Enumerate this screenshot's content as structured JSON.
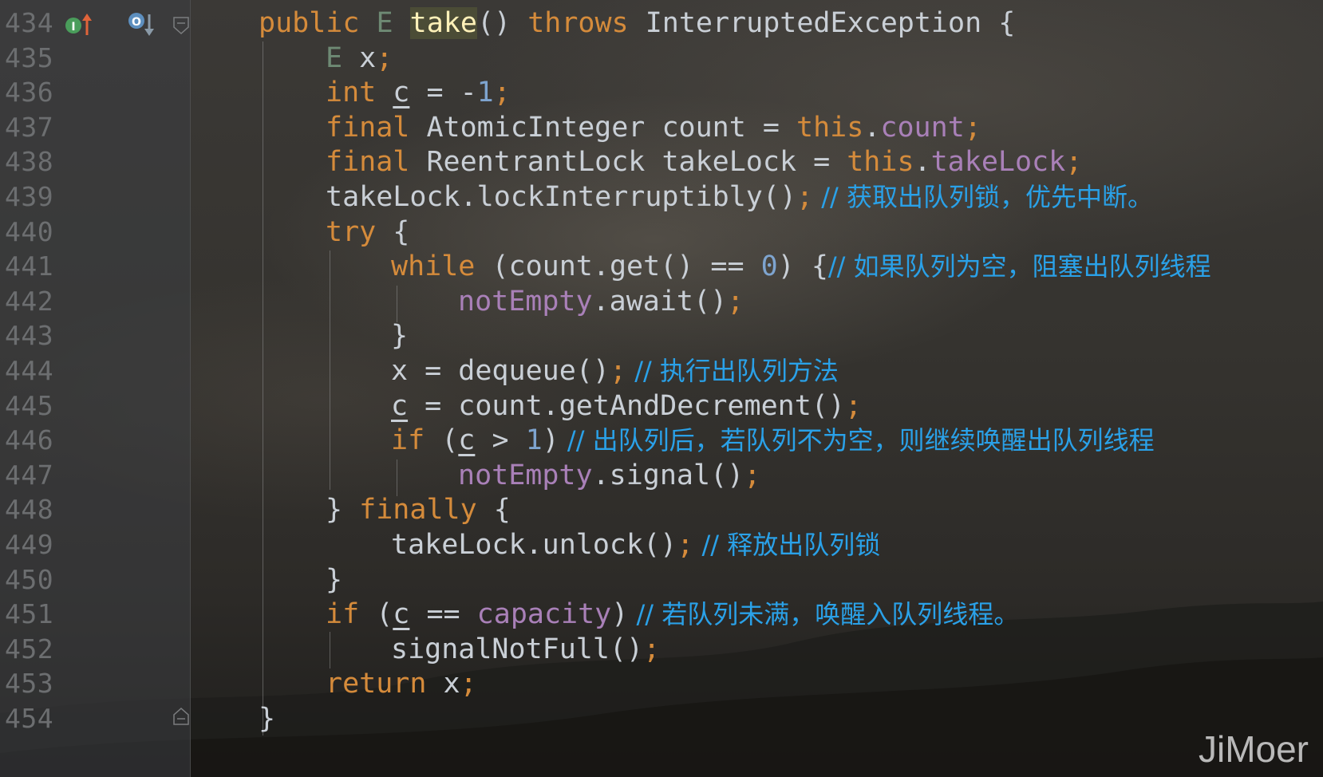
{
  "editor": {
    "lines": [
      {
        "num": "434",
        "segments": [
          {
            "t": "public ",
            "c": "kw"
          },
          {
            "t": "E ",
            "c": "tp"
          },
          {
            "t": "take",
            "c": "fn-hl"
          },
          {
            "t": "() ",
            "c": ""
          },
          {
            "t": "throws ",
            "c": "kw"
          },
          {
            "t": "InterruptedException {",
            "c": ""
          }
        ],
        "comment": ""
      },
      {
        "num": "435",
        "segments": [
          {
            "t": "E ",
            "c": "tp"
          },
          {
            "t": "x",
            "c": ""
          },
          {
            "t": ";",
            "c": "kw"
          }
        ],
        "comment": ""
      },
      {
        "num": "436",
        "segments": [
          {
            "t": "int ",
            "c": "kw"
          },
          {
            "t": "c",
            "c": "u"
          },
          {
            "t": " = -",
            "c": ""
          },
          {
            "t": "1",
            "c": "num"
          },
          {
            "t": ";",
            "c": "kw"
          }
        ],
        "comment": ""
      },
      {
        "num": "437",
        "segments": [
          {
            "t": "final ",
            "c": "kw"
          },
          {
            "t": "AtomicInteger count = ",
            "c": ""
          },
          {
            "t": "this",
            "c": "kw"
          },
          {
            "t": ".",
            "c": ""
          },
          {
            "t": "count",
            "c": "fld"
          },
          {
            "t": ";",
            "c": "kw"
          }
        ],
        "comment": ""
      },
      {
        "num": "438",
        "segments": [
          {
            "t": "final ",
            "c": "kw"
          },
          {
            "t": "ReentrantLock takeLock = ",
            "c": ""
          },
          {
            "t": "this",
            "c": "kw"
          },
          {
            "t": ".",
            "c": ""
          },
          {
            "t": "takeLock",
            "c": "fld"
          },
          {
            "t": ";",
            "c": "kw"
          }
        ],
        "comment": ""
      },
      {
        "num": "439",
        "segments": [
          {
            "t": "takeLock.lockInterruptibly()",
            "c": ""
          },
          {
            "t": ";",
            "c": "kw"
          }
        ],
        "comment": " // 获取出队列锁，优先中断。"
      },
      {
        "num": "440",
        "segments": [
          {
            "t": "try ",
            "c": "kw"
          },
          {
            "t": "{",
            "c": ""
          }
        ],
        "comment": ""
      },
      {
        "num": "441",
        "segments": [
          {
            "t": "while ",
            "c": "kw"
          },
          {
            "t": "(count.get() == ",
            "c": ""
          },
          {
            "t": "0",
            "c": "num"
          },
          {
            "t": ") {",
            "c": ""
          }
        ],
        "comment": "// 如果队列为空，阻塞出队列线程"
      },
      {
        "num": "442",
        "segments": [
          {
            "t": "notEmpty",
            "c": "fld"
          },
          {
            "t": ".await()",
            "c": ""
          },
          {
            "t": ";",
            "c": "kw"
          }
        ],
        "comment": ""
      },
      {
        "num": "443",
        "segments": [
          {
            "t": "}",
            "c": ""
          }
        ],
        "comment": ""
      },
      {
        "num": "444",
        "segments": [
          {
            "t": "x = dequeue()",
            "c": ""
          },
          {
            "t": ";",
            "c": "kw"
          }
        ],
        "comment": " // 执行出队列方法"
      },
      {
        "num": "445",
        "segments": [
          {
            "t": "c",
            "c": "u"
          },
          {
            "t": " = count.getAndDecrement()",
            "c": ""
          },
          {
            "t": ";",
            "c": "kw"
          }
        ],
        "comment": ""
      },
      {
        "num": "446",
        "segments": [
          {
            "t": "if ",
            "c": "kw"
          },
          {
            "t": "(",
            "c": ""
          },
          {
            "t": "c",
            "c": "u"
          },
          {
            "t": " > ",
            "c": ""
          },
          {
            "t": "1",
            "c": "num"
          },
          {
            "t": ")",
            "c": ""
          }
        ],
        "comment": " // 出队列后，若队列不为空，则继续唤醒出队列线程"
      },
      {
        "num": "447",
        "segments": [
          {
            "t": "notEmpty",
            "c": "fld"
          },
          {
            "t": ".signal()",
            "c": ""
          },
          {
            "t": ";",
            "c": "kw"
          }
        ],
        "comment": ""
      },
      {
        "num": "448",
        "segments": [
          {
            "t": "} ",
            "c": ""
          },
          {
            "t": "finally ",
            "c": "kw"
          },
          {
            "t": "{",
            "c": ""
          }
        ],
        "comment": ""
      },
      {
        "num": "449",
        "segments": [
          {
            "t": "takeLock.unlock()",
            "c": ""
          },
          {
            "t": ";",
            "c": "kw"
          }
        ],
        "comment": " // 释放出队列锁"
      },
      {
        "num": "450",
        "segments": [
          {
            "t": "}",
            "c": ""
          }
        ],
        "comment": ""
      },
      {
        "num": "451",
        "segments": [
          {
            "t": "if ",
            "c": "kw"
          },
          {
            "t": "(",
            "c": ""
          },
          {
            "t": "c",
            "c": "u"
          },
          {
            "t": " == ",
            "c": ""
          },
          {
            "t": "capacity",
            "c": "fld"
          },
          {
            "t": ")",
            "c": ""
          }
        ],
        "comment": " // 若队列未满，唤醒入队列线程。"
      },
      {
        "num": "452",
        "segments": [
          {
            "t": "signalNotFull()",
            "c": ""
          },
          {
            "t": ";",
            "c": "kw"
          }
        ],
        "comment": ""
      },
      {
        "num": "453",
        "segments": [
          {
            "t": "return ",
            "c": "kw"
          },
          {
            "t": "x",
            "c": ""
          },
          {
            "t": ";",
            "c": "kw"
          }
        ],
        "comment": ""
      },
      {
        "num": "454",
        "segments": [
          {
            "t": "}",
            "c": ""
          }
        ],
        "comment": ""
      }
    ]
  },
  "gutter_icons": {
    "implements_icon": "implementing-method-up-icon",
    "overrides_icon": "overridden-method-down-icon",
    "fold_icon": "fold-marker-icon"
  },
  "watermark": "JiMoer"
}
